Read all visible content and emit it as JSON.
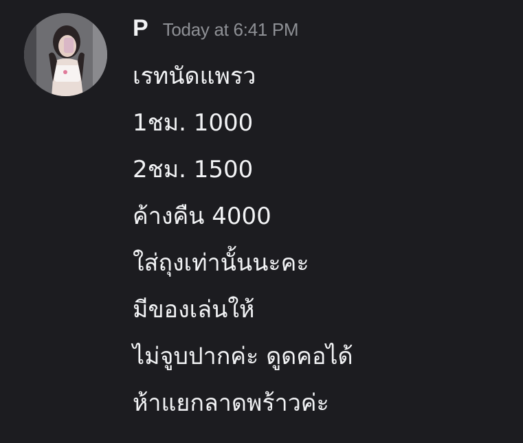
{
  "message": {
    "author": "P",
    "timestamp": "Today at 6:41 PM",
    "lines": [
      "เรทนัดแพรว",
      "1ชม. 1000",
      "2ชม. 1500",
      "ค้างคืน 4000",
      "ใส่ถุงเท่านั้นนะคะ",
      "มีของเล่นให้",
      "ไม่จูบปากค่ะ ดูดคอได้",
      "ห้าแยกลาดพร้าวค่ะ"
    ]
  },
  "colors": {
    "background": "#1c1c20",
    "text": "#f2f3f5",
    "timestamp": "#8e9095"
  }
}
